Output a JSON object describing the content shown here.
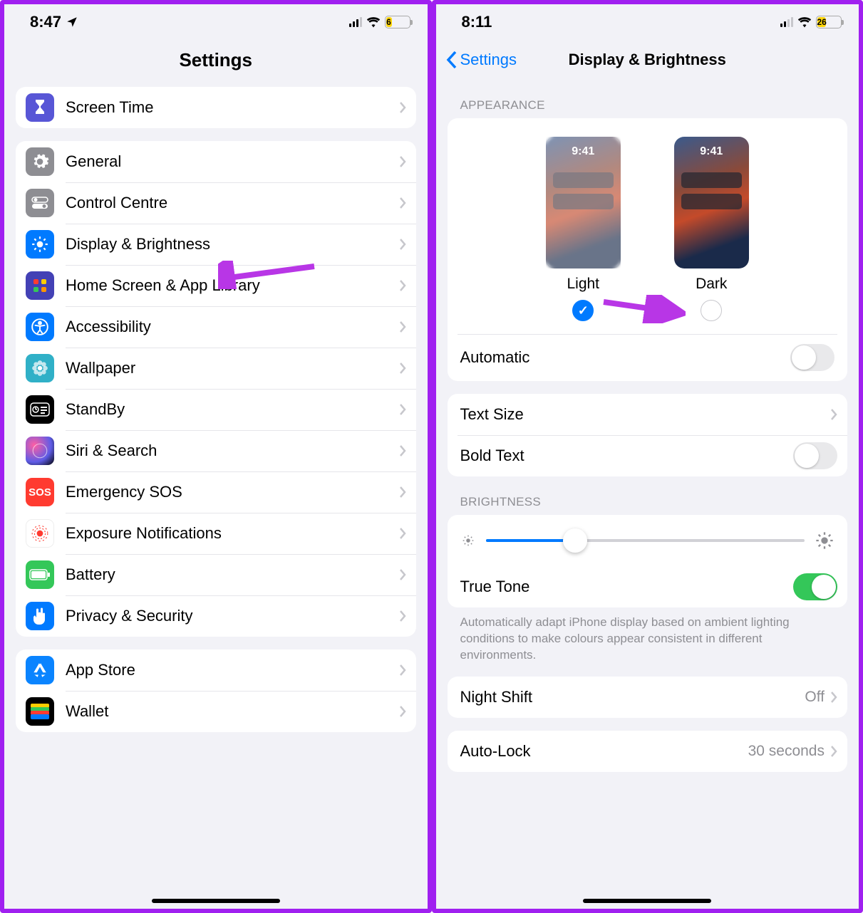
{
  "left": {
    "status": {
      "time": "8:47",
      "battery": "6"
    },
    "title": "Settings",
    "group0": {
      "screentime": "Screen Time"
    },
    "group1": {
      "general": "General",
      "control": "Control Centre",
      "display": "Display & Brightness",
      "home": "Home Screen & App Library",
      "accessibility": "Accessibility",
      "wallpaper": "Wallpaper",
      "standby": "StandBy",
      "siri": "Siri & Search",
      "sos": "Emergency SOS",
      "exposure": "Exposure Notifications",
      "battery": "Battery",
      "privacy": "Privacy & Security"
    },
    "group2": {
      "appstore": "App Store",
      "wallet": "Wallet"
    }
  },
  "right": {
    "status": {
      "time": "8:11",
      "battery": "26"
    },
    "back": "Settings",
    "title": "Display & Brightness",
    "appearance_header": "APPEARANCE",
    "appearance": {
      "thumb_time": "9:41",
      "light_label": "Light",
      "dark_label": "Dark",
      "automatic": "Automatic"
    },
    "text": {
      "textsize": "Text Size",
      "bold": "Bold Text"
    },
    "brightness_header": "BRIGHTNESS",
    "brightness": {
      "truetone": "True Tone",
      "footer": "Automatically adapt iPhone display based on ambient lighting conditions to make colours appear consistent in different environments."
    },
    "nightshift": {
      "label": "Night Shift",
      "value": "Off"
    },
    "autolock": {
      "label": "Auto-Lock",
      "value": "30 seconds"
    }
  }
}
